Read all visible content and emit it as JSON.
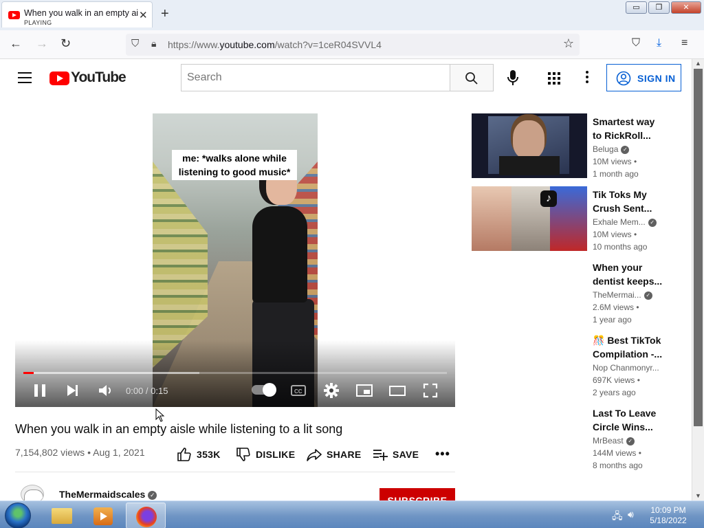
{
  "browser": {
    "tab_title": "When you walk in an empty aisle while listening to a lit song - YouTube",
    "tab_status": "PLAYING",
    "url_prefix": "https://www.",
    "url_domain": "youtube.com",
    "url_path": "/watch?v=1ceR04SVVL4"
  },
  "header": {
    "logo_text": "YouTube",
    "search_placeholder": "Search",
    "sign_in_label": "SIGN IN"
  },
  "player": {
    "caption_line1": "me: *walks alone while",
    "caption_line2": "listening to good music*",
    "current_time": "0:00",
    "duration": "0:15",
    "progress_fraction": 0.024,
    "buffered_fraction": 0.415
  },
  "video": {
    "title": "When you walk in an empty aisle while listening to a lit song",
    "views": "7,154,802 views",
    "date": "Aug 1, 2021",
    "likes": "353K",
    "dislike_label": "DISLIKE",
    "share_label": "SHARE",
    "save_label": "SAVE",
    "channel_name": "TheMermaidscales",
    "subscribe_label": "SUBSCRIBE"
  },
  "recommendations": [
    {
      "title1": "Smartest way",
      "title2": "to RickRoll...",
      "channel": "Beluga",
      "views": "10M views •",
      "ago": "1 month ago",
      "verified": true
    },
    {
      "title1": "Tik Toks My",
      "title2": "Crush Sent...",
      "channel": "Exhale Mem...",
      "views": "10M views •",
      "ago": "10 months ago",
      "verified": true
    },
    {
      "title1": "When your",
      "title2": "dentist keeps...",
      "channel": "TheMermai...",
      "views": "2.6M views •",
      "ago": "1 year ago",
      "verified": true
    },
    {
      "title1": "🎊 Best TikTok",
      "title2": "Compilation -...",
      "channel": "Nop Chanmonyr...",
      "views": "697K views •",
      "ago": "2 years ago",
      "verified": false
    },
    {
      "title1": "Last To Leave",
      "title2": "Circle Wins...",
      "channel": "MrBeast",
      "views": "144M views •",
      "ago": "8 months ago",
      "verified": true
    }
  ],
  "taskbar": {
    "time": "10:09 PM",
    "date": "5/18/2022"
  },
  "colors": {
    "accent_red": "#ff0000",
    "link_blue": "#065fd4",
    "subscribe_red": "#cc0000"
  }
}
